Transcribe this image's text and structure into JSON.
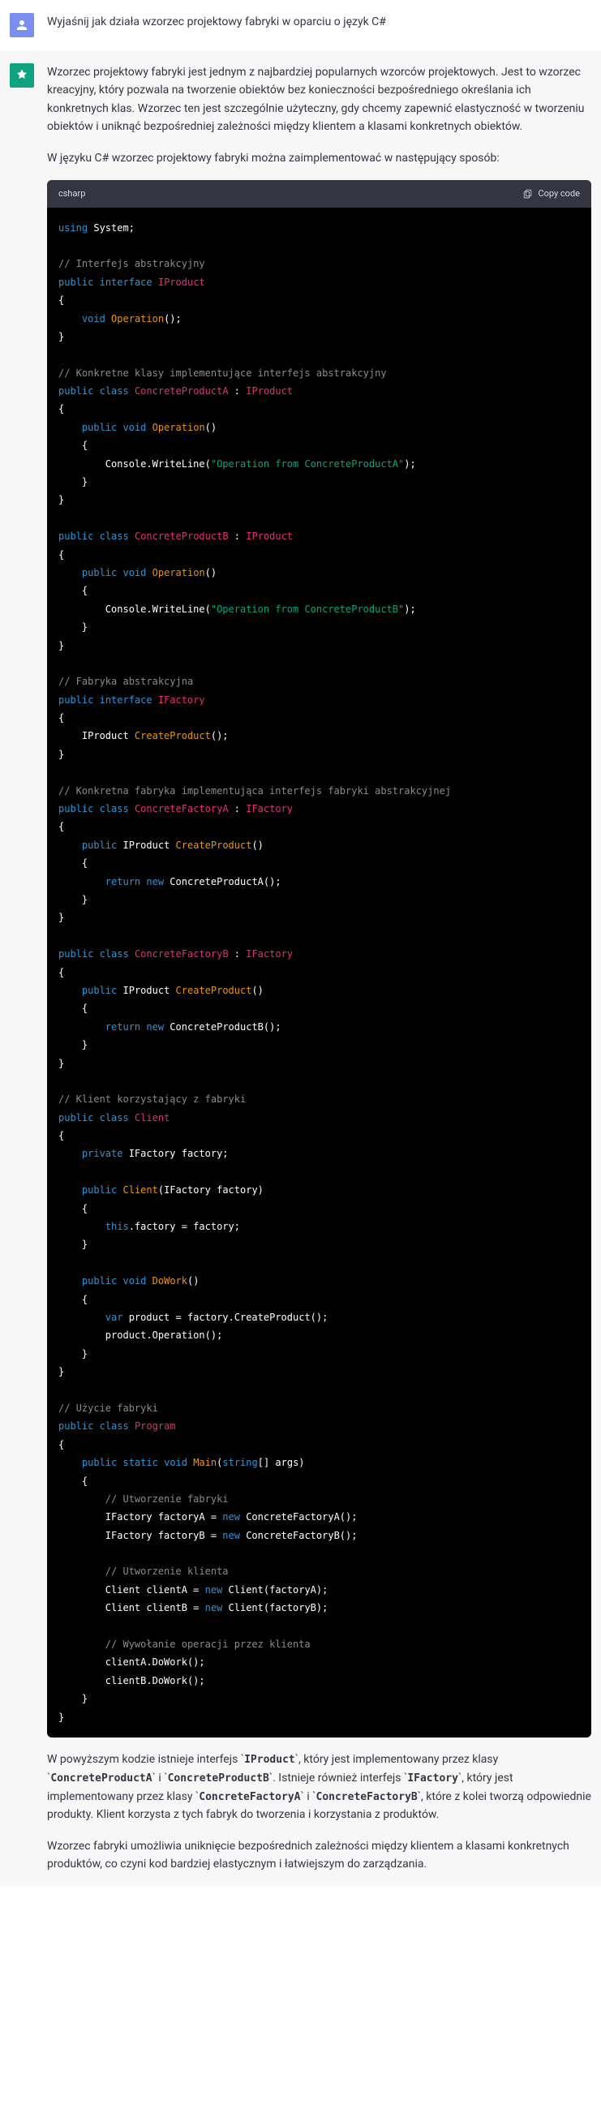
{
  "user": {
    "prompt": "Wyjaśnij jak działa wzorzec projektowy fabryki w oparciu o język C#"
  },
  "assistant": {
    "intro_p1": "Wzorzec projektowy fabryki jest jednym z najbardziej popularnych wzorców projektowych. Jest to wzorzec kreacyjny, który pozwala na tworzenie obiektów bez konieczności bezpośredniego określania ich konkretnych klas. Wzorzec ten jest szczególnie użyteczny, gdy chcemy zapewnić elastyczność w tworzeniu obiektów i uniknąć bezpośredniej zależności między klientem a klasami konkretnych obiektów.",
    "intro_p2": "W języku C# wzorzec projektowy fabryki można zaimplementować w następujący sposób:",
    "code_lang": "csharp",
    "copy_label": "Copy code",
    "outro_p1_parts": {
      "t1": "W powyższym kodzie istnieje interfejs `",
      "c1": "IProduct",
      "t2": "`, który jest implementowany przez klasy `",
      "c2": "ConcreteProductA",
      "t3": "` i `",
      "c3": "ConcreteProductB",
      "t4": "`. Istnieje również interfejs `",
      "c4": "IFactory",
      "t5": "`, który jest implementowany przez klasy `",
      "c5": "ConcreteFactoryA",
      "t6": "` i `",
      "c6": "ConcreteFactoryB",
      "t7": "`, które z kolei tworzą odpowiednie produkty. Klient korzysta z tych fabryk do tworzenia i korzystania z produktów."
    },
    "outro_p2": "Wzorzec fabryki umożliwia uniknięcie bezpośrednich zależności między klientem a klasami konkretnych produktów, co czyni kod bardziej elastycznym i łatwiejszym do zarządzania.",
    "code": {
      "l1_using": "using",
      "l1_system": " System;",
      "c1": "// Interfejs abstrakcyjny",
      "kw_public": "public",
      "kw_interface": "interface",
      "kw_class": "class",
      "kw_void": "void",
      "kw_return": "return",
      "kw_new": "new",
      "kw_private": "private",
      "kw_static": "static",
      "kw_this": "this",
      "kw_var": "var",
      "kw_string": "string",
      "n_IProduct": "IProduct",
      "n_Operation": "Operation",
      "n_ConcreteProductA": "ConcreteProductA",
      "n_ConcreteProductB": "ConcreteProductB",
      "n_IFactory": "IFactory",
      "n_CreateProduct": "CreateProduct",
      "n_ConcreteFactoryA": "ConcreteFactoryA",
      "n_ConcreteFactoryB": "ConcreteFactoryB",
      "n_Client": "Client",
      "n_DoWork": "DoWork",
      "n_Program": "Program",
      "n_Main": "Main",
      "c2": "// Konkretne klasy implementujące interfejs abstrakcyjny",
      "s1": "\"Operation from ConcreteProductA\"",
      "s2": "\"Operation from ConcreteProductB\"",
      "c3": "// Fabryka abstrakcyjna",
      "c4": "// Konkretna fabryka implementująca interfejs fabryki abstrakcyjnej",
      "c5": "// Klient korzystający z fabryki",
      "c6": "// Użycie fabryki",
      "c7": "// Utworzenie fabryki",
      "c8": "// Utworzenie klienta",
      "c9": "// Wywołanie operacji przez klienta",
      "txt_console": "Console.WriteLine(",
      "txt_close_paren_semi": ");",
      "txt_factory_field": " IFactory factory;",
      "txt_client_ctor_sig": "(IFactory factory)",
      "txt_this_assign": ".factory = factory;",
      "txt_var_product": " product = factory.CreateProduct();",
      "txt_product_op": "product.Operation();",
      "txt_main_args": "[] args)",
      "txt_factA": "IFactory factoryA = ",
      "txt_factB": "IFactory factoryB = ",
      "txt_newFactA": " ConcreteFactoryA();",
      "txt_newFactB": " ConcreteFactoryB();",
      "txt_clientA": "Client clientA = ",
      "txt_clientB": "Client clientB = ",
      "txt_newClientA": " Client(factoryA);",
      "txt_newClientB": " Client(factoryB);",
      "txt_doWorkA": "clientA.DoWork();",
      "txt_doWorkB": "clientB.DoWork();",
      "txt_retNewA": " ConcreteProductA();",
      "txt_retNewB": " ConcreteProductB();"
    }
  }
}
